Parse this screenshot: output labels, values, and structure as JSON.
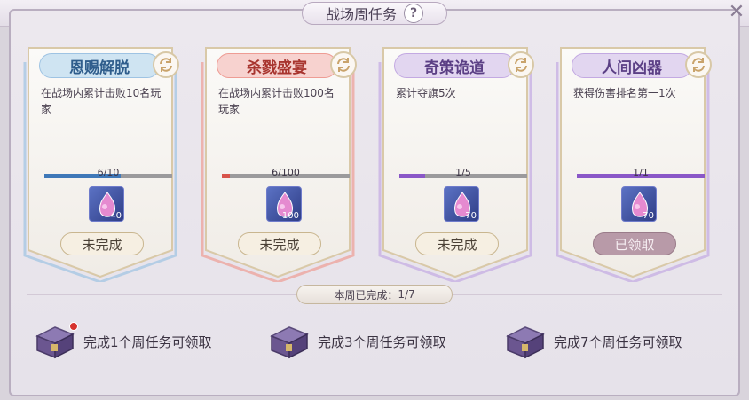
{
  "window": {
    "title": "战场周任务",
    "help_label": "?",
    "close_label": "✕"
  },
  "tasks": [
    {
      "name": "恩赐解脱",
      "description": "在战场内累计击败10名玩家",
      "progress_text": "6/10",
      "progress": 0.6,
      "reward_qty": "40",
      "status": "未完成",
      "theme": "blue",
      "accent": "#3f78b8",
      "title_bg": "#cfe4f2",
      "title_color": "#2f5d8c",
      "frame_glow": "#9ec3e3"
    },
    {
      "name": "杀戮盛宴",
      "description": "在战场内累计击败100名玩家",
      "progress_text": "6/100",
      "progress": 0.06,
      "reward_qty": "100",
      "status": "未完成",
      "theme": "red",
      "accent": "#d8544b",
      "title_bg": "#f7d2cf",
      "title_color": "#a8352f",
      "frame_glow": "#ee9c94"
    },
    {
      "name": "奇策诡道",
      "description": "累计夺旗5次",
      "progress_text": "1/5",
      "progress": 0.2,
      "reward_qty": "70",
      "status": "未完成",
      "theme": "purple",
      "accent": "#8a57c7",
      "title_bg": "#e2d6f0",
      "title_color": "#5b3f85",
      "frame_glow": "#c3a9e2"
    },
    {
      "name": "人间凶器",
      "description": "获得伤害排名第一1次",
      "progress_text": "1/1",
      "progress": 1.0,
      "reward_qty": "70",
      "status": "已领取",
      "theme": "purple",
      "accent": "#8a57c7",
      "title_bg": "#e2d6f0",
      "title_color": "#5b3f85",
      "frame_glow": "#c3a9e2"
    }
  ],
  "summary": {
    "label": "本周已完成",
    "separator": "：",
    "value": "1/7"
  },
  "chests": [
    {
      "label": "完成1个周任务可领取",
      "has_alert": true
    },
    {
      "label": "完成3个周任务可领取",
      "has_alert": false
    },
    {
      "label": "完成7个周任务可领取",
      "has_alert": false
    }
  ]
}
